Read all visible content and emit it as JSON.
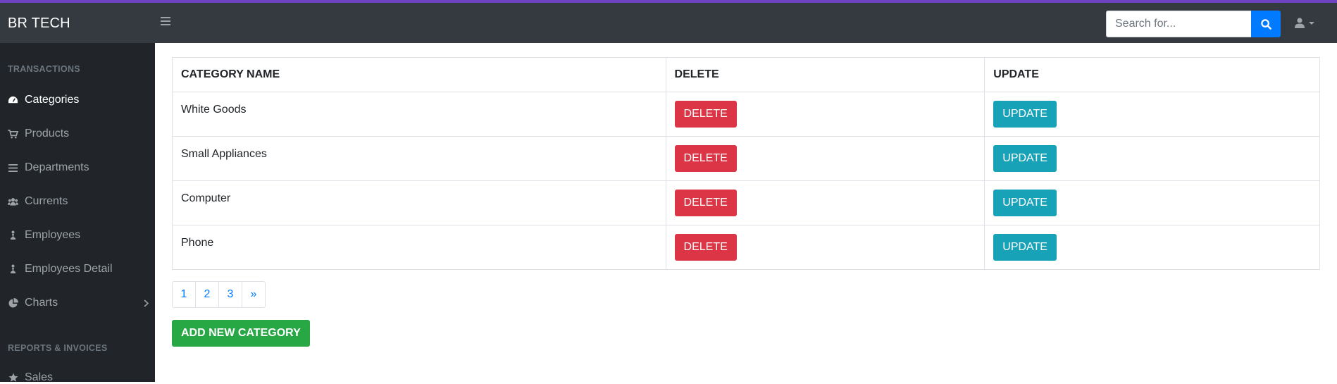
{
  "app": {
    "brand": "BR TECH",
    "accent_color": "#6f42c1"
  },
  "topnav": {
    "menu_icon": "bars-icon",
    "search": {
      "placeholder": "Search for...",
      "value": "",
      "button_icon": "search-icon"
    },
    "user_icon": "user-icon"
  },
  "sidebar": {
    "sections": [
      {
        "heading": "TRANSACTIONS"
      },
      {
        "heading": "REPORTS & INVOICES"
      }
    ],
    "items": [
      {
        "label": "Categories",
        "icon": "tachometer-icon",
        "active": true
      },
      {
        "label": "Products",
        "icon": "shopping-cart-icon"
      },
      {
        "label": "Departments",
        "icon": "list-icon"
      },
      {
        "label": "Currents",
        "icon": "users-icon"
      },
      {
        "label": "Employees",
        "icon": "employee-icon"
      },
      {
        "label": "Employees Detail",
        "icon": "employee-icon"
      },
      {
        "label": "Charts",
        "icon": "pie-chart-icon"
      },
      {
        "label": "Sales",
        "icon": "star-icon"
      }
    ]
  },
  "table": {
    "headers": [
      "CATEGORY NAME",
      "DELETE",
      "UPDATE"
    ],
    "rows": [
      {
        "name": "White Goods",
        "delete_label": "DELETE",
        "update_label": "UPDATE"
      },
      {
        "name": "Small Appliances",
        "delete_label": "DELETE",
        "update_label": "UPDATE"
      },
      {
        "name": "Computer",
        "delete_label": "DELETE",
        "update_label": "UPDATE"
      },
      {
        "name": "Phone",
        "delete_label": "DELETE",
        "update_label": "UPDATE"
      }
    ]
  },
  "pagination": {
    "pages": [
      "1",
      "2",
      "3"
    ],
    "next": "»"
  },
  "actions": {
    "add_label": "ADD NEW CATEGORY"
  },
  "colors": {
    "danger": "#dc3545",
    "info": "#17a2b8",
    "success": "#28a745",
    "primary": "#007bff"
  }
}
